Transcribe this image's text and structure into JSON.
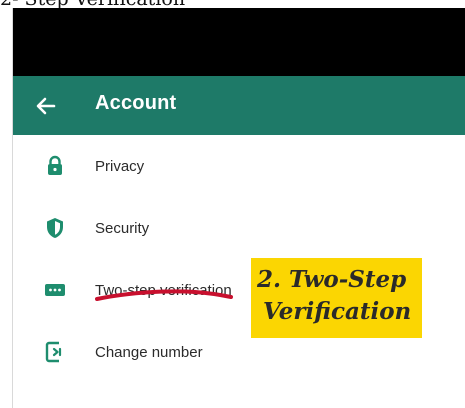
{
  "caption": "2- Step Verification",
  "header": {
    "title": "Account",
    "bar_color": "#1e7a68",
    "back_icon": "arrow-left-icon"
  },
  "menu": {
    "icon_color": "#1e8d6e",
    "items": [
      {
        "label": "Privacy",
        "icon": "lock-icon"
      },
      {
        "label": "Security",
        "icon": "shield-icon"
      },
      {
        "label": "Two-step verification",
        "icon": "dots-icon"
      },
      {
        "label": "Change number",
        "icon": "phone-change-icon"
      }
    ]
  },
  "annotation": {
    "line1": "2. Two-Step",
    "line2": "Verification",
    "badge_color": "#fbd602",
    "underline_color": "#c8102e"
  }
}
